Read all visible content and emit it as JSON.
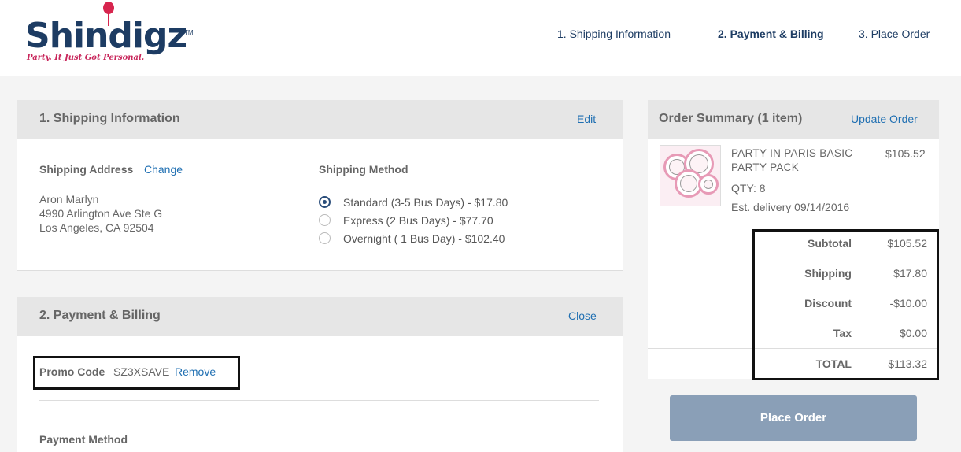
{
  "brand": {
    "name": "Shindigz",
    "tm": "TM",
    "tagline": "Party. It Just Got Personal."
  },
  "steps": {
    "step1": "1. Shipping Information",
    "step2_num": "2.",
    "step2_label": "Payment & Billing",
    "step3": "3. Place Order"
  },
  "shipping": {
    "title": "1. Shipping Information",
    "edit": "Edit",
    "address_label": "Shipping Address",
    "change": "Change",
    "name": "Aron Marlyn",
    "street": "4990 Arlington Ave Ste G",
    "city": "Los Angeles, CA 92504",
    "method_label": "Shipping Method",
    "options": [
      {
        "label": "Standard (3-5 Bus Days) - $17.80",
        "selected": true
      },
      {
        "label": "Express (2 Bus Days) - $77.70",
        "selected": false
      },
      {
        "label": "Overnight ( 1 Bus Day) - $102.40",
        "selected": false
      }
    ]
  },
  "payment": {
    "title": "2. Payment & Billing",
    "close": "Close",
    "promo_label": "Promo Code",
    "promo_code": "SZ3XSAVE",
    "remove": "Remove",
    "method_label": "Payment Method"
  },
  "summary": {
    "title": "Order Summary (1 item)",
    "update": "Update Order",
    "item": {
      "name_line1": "PARTY IN PARIS BASIC",
      "name_line2": "PARTY PACK",
      "price": "$105.52",
      "qty": "QTY: 8",
      "delivery": "Est. delivery 09/14/2016"
    },
    "rows": [
      {
        "label": "Subtotal",
        "value": "$105.52"
      },
      {
        "label": "Shipping",
        "value": "$17.80"
      },
      {
        "label": "Discount",
        "value": "-$10.00"
      },
      {
        "label": "Tax",
        "value": "$0.00"
      }
    ],
    "total_label": "TOTAL",
    "total_value": "$113.32",
    "place_order": "Place Order"
  },
  "colors": {
    "brand_navy": "#1d3c63",
    "brand_pink": "#c8265b",
    "link_blue": "#1f6fb2",
    "button_disabled": "#8a9fb7"
  }
}
